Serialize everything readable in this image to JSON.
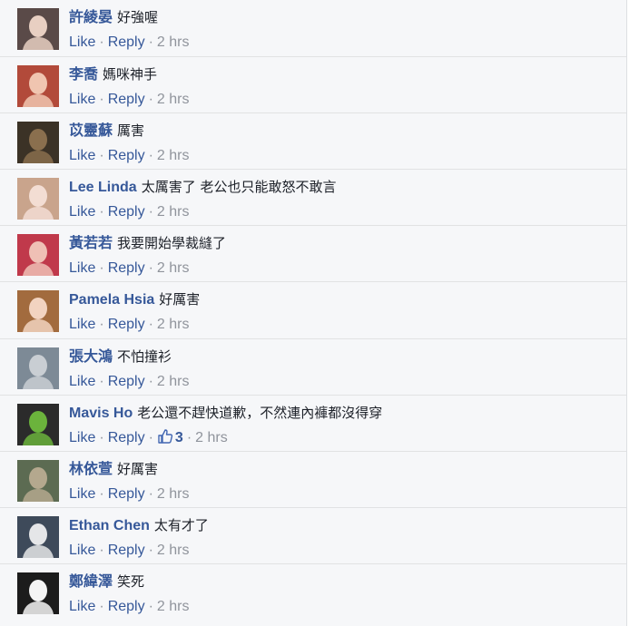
{
  "comments": [
    {
      "author": "許綾晏",
      "text": "好強喔",
      "like_label": "Like",
      "reply_label": "Reply",
      "time": "2 hrs",
      "avatar_colors": [
        "#5a4a48",
        "#e8cfc2"
      ]
    },
    {
      "author": "李喬",
      "text": "媽咪神手",
      "like_label": "Like",
      "reply_label": "Reply",
      "time": "2 hrs",
      "avatar_colors": [
        "#b24a3a",
        "#f0c5b0"
      ]
    },
    {
      "author": "苡靈蘇",
      "text": "厲害",
      "like_label": "Like",
      "reply_label": "Reply",
      "time": "2 hrs",
      "avatar_colors": [
        "#3b3226",
        "#8a6f4e"
      ]
    },
    {
      "author": "Lee Linda",
      "text": "太厲害了 老公也只能敢怒不敢言",
      "like_label": "Like",
      "reply_label": "Reply",
      "time": "2 hrs",
      "avatar_colors": [
        "#c9a48c",
        "#f3ddd3"
      ]
    },
    {
      "author": "黃若若",
      "text": "我要開始學裁縫了",
      "like_label": "Like",
      "reply_label": "Reply",
      "time": "2 hrs",
      "avatar_colors": [
        "#c0394b",
        "#efc0b5"
      ]
    },
    {
      "author": "Pamela Hsia",
      "text": "好厲害",
      "like_label": "Like",
      "reply_label": "Reply",
      "time": "2 hrs",
      "avatar_colors": [
        "#a26b3e",
        "#f2d3c0"
      ]
    },
    {
      "author": "張大鴻",
      "text": "不怕撞衫",
      "like_label": "Like",
      "reply_label": "Reply",
      "time": "2 hrs",
      "avatar_colors": [
        "#7d8a96",
        "#c9ced3"
      ]
    },
    {
      "author": "Mavis Ho",
      "text": "老公還不趕快道歉，不然連內褲都沒得穿",
      "like_label": "Like",
      "reply_label": "Reply",
      "likes": "3",
      "time": "2 hrs",
      "avatar_colors": [
        "#2b2b2b",
        "#6bb33c"
      ]
    },
    {
      "author": "林依萱",
      "text": "好厲害",
      "like_label": "Like",
      "reply_label": "Reply",
      "time": "2 hrs",
      "avatar_colors": [
        "#5c6b52",
        "#b4a88e"
      ]
    },
    {
      "author": "Ethan Chen",
      "text": "太有才了",
      "like_label": "Like",
      "reply_label": "Reply",
      "time": "2 hrs",
      "avatar_colors": [
        "#3e4a5a",
        "#e5e6e8"
      ]
    },
    {
      "author": "鄭緯澤",
      "text": "笑死",
      "like_label": "Like",
      "reply_label": "Reply",
      "time": "2 hrs",
      "avatar_colors": [
        "#1c1c1c",
        "#f4f4f4"
      ]
    }
  ],
  "separator": "·",
  "colors": {
    "link": "#365899",
    "muted": "#90949c",
    "text": "#1d2129",
    "background": "#f6f7f9"
  }
}
